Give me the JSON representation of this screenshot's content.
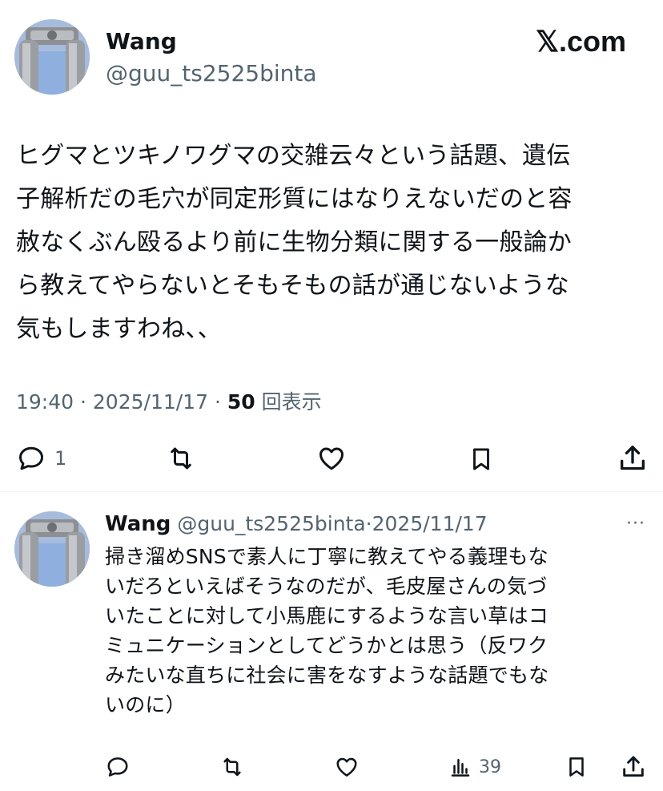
{
  "main_post": {
    "author_name": "Wang",
    "author_handle": "@guu_ts2525binta",
    "brand": "𝕏.com",
    "text_lines": [
      "ヒグマとツキノワグマの交雑云々という話題、遺伝",
      "子解析だの毛穴が同定形質にはなりえないだのと容",
      "赦なくぶん殴るより前に生物分類に関する一般論か",
      "ら教えてやらないとそもそもの話が通じないような",
      "気もしますわね、、"
    ],
    "time": "19:40",
    "date": "2025/11/17",
    "separator": "·",
    "views_count": "50",
    "views_label": "回表示",
    "reply_count": "1",
    "icons": [
      "reply-icon",
      "repost-icon",
      "like-icon",
      "bookmark-icon",
      "share-icon"
    ]
  },
  "reply_post": {
    "author_name": "Wang",
    "author_handle": "@guu_ts2525binta",
    "separator": "·",
    "date": "2025/11/17",
    "more": "···",
    "text_lines": [
      "掃き溜めSNSで素人に丁寧に教えてやる義理もな",
      "いだろといえばそうなのだが、毛皮屋さんの気づ",
      "いたことに対して小馬鹿にするような言い草はコ",
      "ミュニケーションとしてどうかとは思う（反ワク",
      "みたいな直ちに社会に害をなすような話題でもな",
      "いのに）"
    ],
    "views_count": "39",
    "icons": [
      "reply-icon",
      "repost-icon",
      "like-icon",
      "views-icon",
      "bookmark-icon",
      "share-icon"
    ]
  },
  "colors": {
    "text": "#0f1419",
    "muted": "#536471",
    "divider": "#eff3f4",
    "background": "#ffffff"
  }
}
